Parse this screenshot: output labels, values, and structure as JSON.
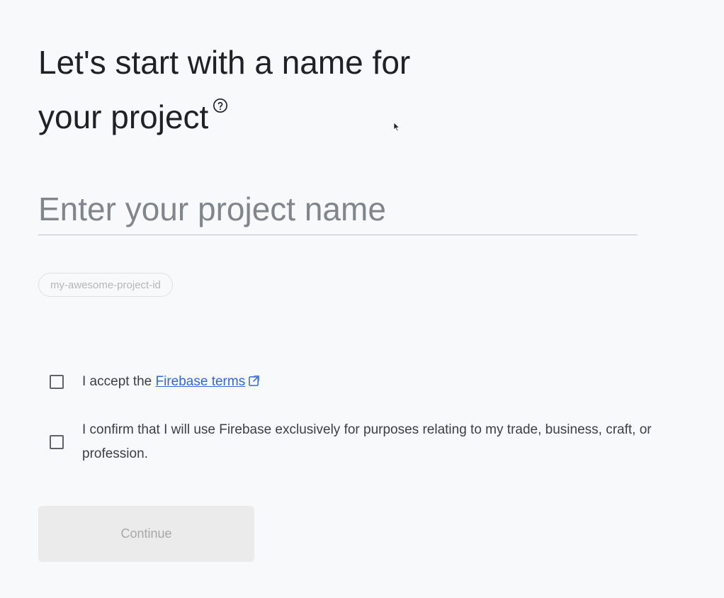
{
  "heading": {
    "line1": "Let's start with a name for",
    "line2": "your project"
  },
  "icons": {
    "help": "help-circle-icon",
    "external_link": "external-link-icon"
  },
  "project_name_input": {
    "placeholder": "Enter your project name",
    "value": ""
  },
  "project_id_chip": {
    "label": "my-awesome-project-id"
  },
  "checkboxes": [
    {
      "label_prefix": "I accept the ",
      "link_text": "Firebase terms",
      "checked": false
    },
    {
      "label": "I confirm that I will use Firebase exclusively for purposes relating to my trade, business, craft, or profession.",
      "checked": false
    }
  ],
  "continue_button": {
    "label": "Continue",
    "enabled": false
  },
  "colors": {
    "background": "#f8f9fa",
    "link": "#3367d6",
    "button_disabled_bg": "#ebebeb",
    "button_disabled_text": "#a8a8a8"
  }
}
